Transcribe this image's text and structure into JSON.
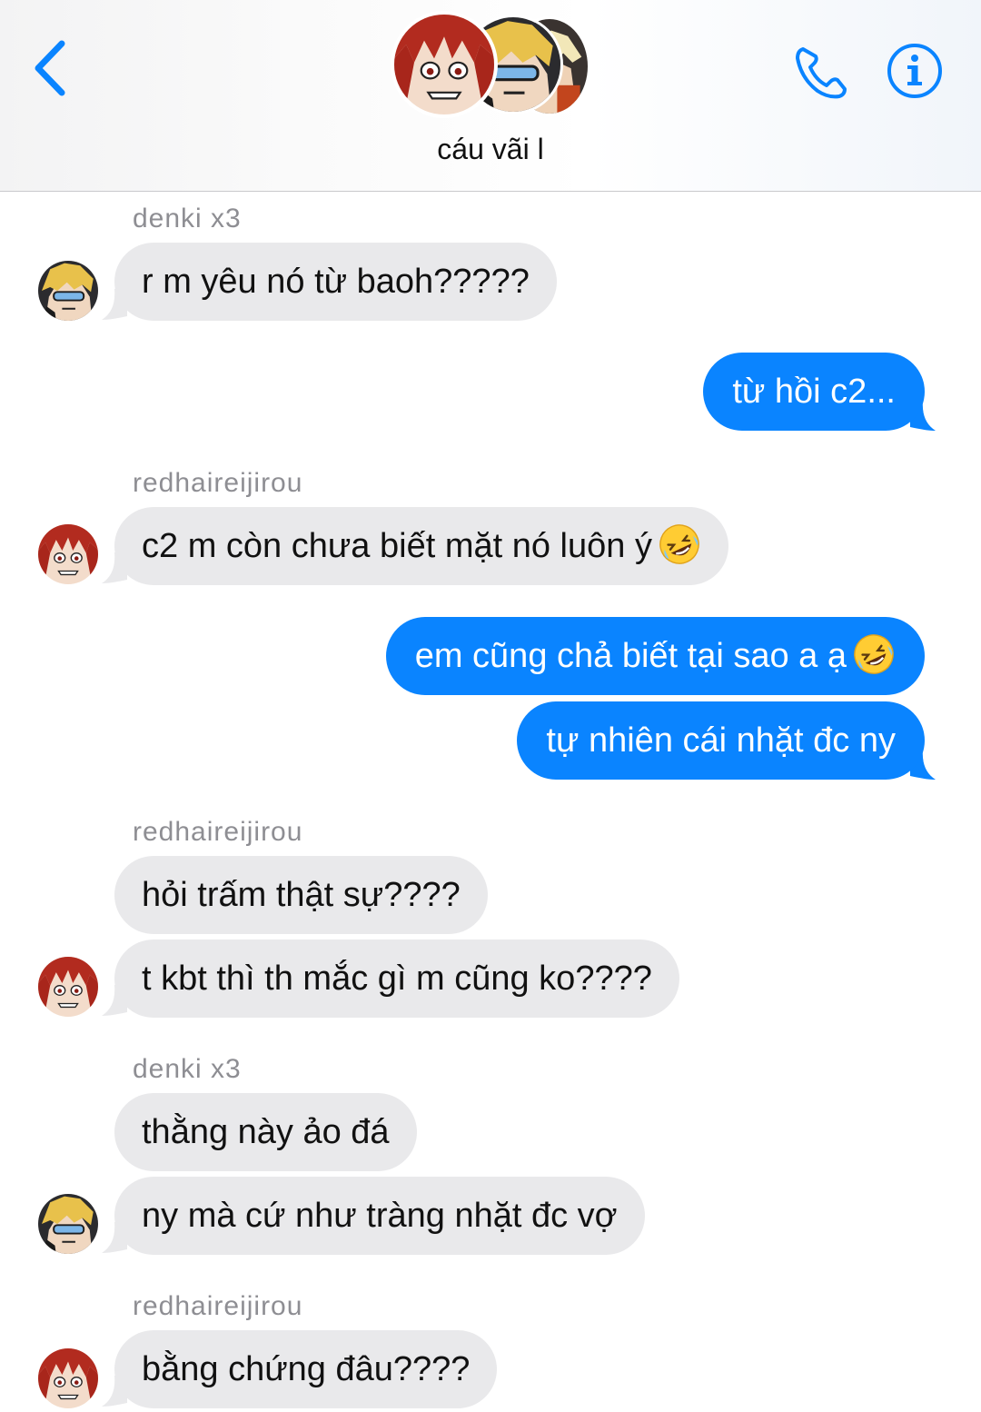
{
  "header": {
    "title": "cáu vãi l",
    "back_icon": "chevron-left-icon",
    "call_icon": "phone-icon",
    "info_icon": "info-icon",
    "accent": "#0a84ff"
  },
  "messages": [
    {
      "sender": "denki x3"
    },
    {
      "text": "r m yêu nó từ baoh?????",
      "direction": "in",
      "avatar": "denki"
    },
    {
      "text": "từ hồi c2...",
      "direction": "out"
    },
    {
      "sender": "redhaireijirou"
    },
    {
      "text": "c2 m còn chưa biết mặt nó luôn ý",
      "emoji": "rolling-laughing-emoji",
      "direction": "in",
      "avatar": "kirishima"
    },
    {
      "text": "em cũng chả biết tại sao a ạ",
      "emoji": "rolling-laughing-emoji",
      "direction": "out"
    },
    {
      "text": "tự nhiên cái nhặt đc ny",
      "direction": "out"
    },
    {
      "sender": "redhaireijirou"
    },
    {
      "text": "hỏi trấm thật sự????",
      "direction": "in"
    },
    {
      "text": "t kbt thì th mắc gì m cũng ko????",
      "direction": "in",
      "avatar": "kirishima"
    },
    {
      "sender": "denki x3"
    },
    {
      "text": "thằng này ảo đá",
      "direction": "in"
    },
    {
      "text": "ny mà cứ như tràng nhặt đc vợ",
      "direction": "in",
      "avatar": "denki"
    },
    {
      "sender": "redhaireijirou"
    },
    {
      "text": "bằng chứng đâu????",
      "direction": "in",
      "avatar": "kirishima"
    }
  ],
  "colors": {
    "outgoing_bubble": "#0a84ff",
    "incoming_bubble": "#e9e9eb",
    "sender_name": "#8e8e93"
  }
}
